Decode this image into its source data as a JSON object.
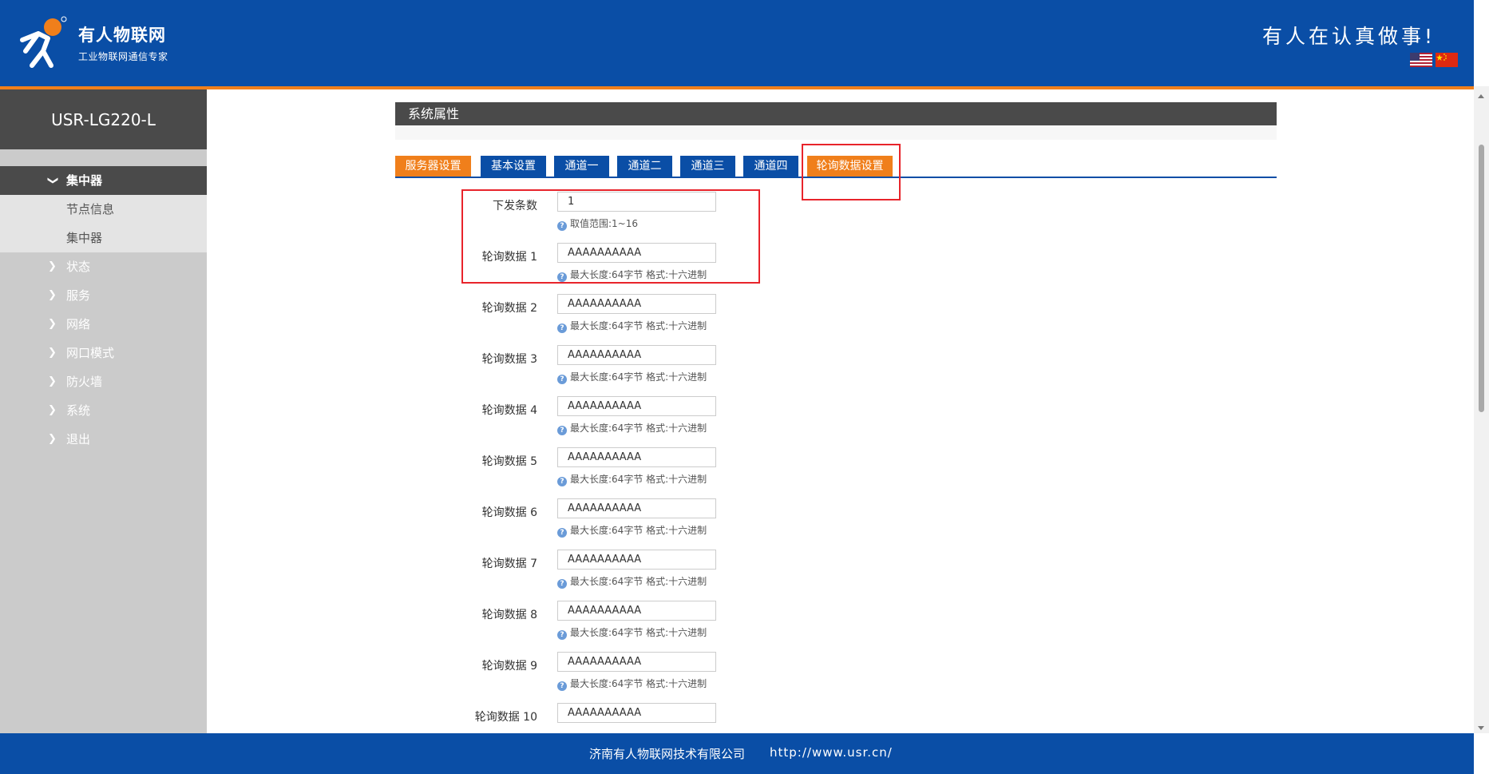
{
  "header": {
    "brand_name": "有人物联网",
    "brand_sub": "工业物联网通信专家",
    "slogan": "有人在认真做事!",
    "lang_flags": [
      "us-flag-icon",
      "cn-flag-icon"
    ],
    "colors": {
      "primary": "#0a4ea6",
      "accent": "#f07f1b"
    }
  },
  "sidebar": {
    "device": "USR-LG220-L",
    "items": [
      {
        "label": "集中器",
        "state": "expanded"
      },
      {
        "label": "节点信息",
        "state": "sub"
      },
      {
        "label": "集中器",
        "state": "sub"
      },
      {
        "label": "状态",
        "state": "collapsed"
      },
      {
        "label": "服务",
        "state": "collapsed"
      },
      {
        "label": "网络",
        "state": "collapsed"
      },
      {
        "label": "网口模式",
        "state": "collapsed"
      },
      {
        "label": "防火墙",
        "state": "collapsed"
      },
      {
        "label": "系统",
        "state": "collapsed"
      },
      {
        "label": "退出",
        "state": "collapsed"
      }
    ]
  },
  "main": {
    "section_title": "系统属性",
    "tabs": [
      {
        "label": "服务器设置",
        "color": "orange"
      },
      {
        "label": "基本设置",
        "color": "blue"
      },
      {
        "label": "通道一",
        "color": "blue"
      },
      {
        "label": "通道二",
        "color": "blue"
      },
      {
        "label": "通道三",
        "color": "blue"
      },
      {
        "label": "通道四",
        "color": "blue"
      },
      {
        "label": "轮询数据设置",
        "color": "orange",
        "active": true
      }
    ],
    "form": [
      {
        "label": "下发条数",
        "value": "1",
        "hint": "取值范围:1~16"
      },
      {
        "label": "轮询数据 1",
        "value": "AAAAAAAAAA",
        "hint": "最大长度:64字节 格式:十六进制"
      },
      {
        "label": "轮询数据 2",
        "value": "AAAAAAAAAA",
        "hint": "最大长度:64字节 格式:十六进制"
      },
      {
        "label": "轮询数据 3",
        "value": "AAAAAAAAAA",
        "hint": "最大长度:64字节 格式:十六进制"
      },
      {
        "label": "轮询数据 4",
        "value": "AAAAAAAAAA",
        "hint": "最大长度:64字节 格式:十六进制"
      },
      {
        "label": "轮询数据 5",
        "value": "AAAAAAAAAA",
        "hint": "最大长度:64字节 格式:十六进制"
      },
      {
        "label": "轮询数据 6",
        "value": "AAAAAAAAAA",
        "hint": "最大长度:64字节 格式:十六进制"
      },
      {
        "label": "轮询数据 7",
        "value": "AAAAAAAAAA",
        "hint": "最大长度:64字节 格式:十六进制"
      },
      {
        "label": "轮询数据 8",
        "value": "AAAAAAAAAA",
        "hint": "最大长度:64字节 格式:十六进制"
      },
      {
        "label": "轮询数据 9",
        "value": "AAAAAAAAAA",
        "hint": "最大长度:64字节 格式:十六进制"
      },
      {
        "label": "轮询数据 10",
        "value": "AAAAAAAAAA",
        "hint": ""
      }
    ],
    "help_icon": "?"
  },
  "footer": {
    "company": "济南有人物联网技术有限公司",
    "url": "http://www.usr.cn/"
  }
}
